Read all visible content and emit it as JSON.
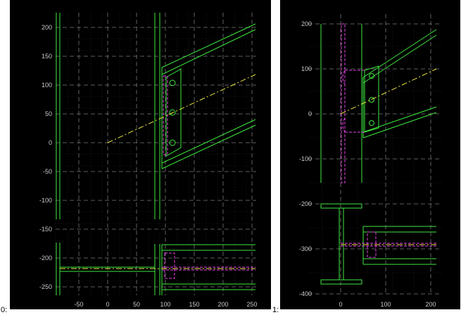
{
  "views": [
    {
      "label": "0:",
      "x_ticks": [
        "-50",
        "0",
        "50",
        "100",
        "150",
        "200",
        "250"
      ],
      "y_ticks": [
        "200",
        "150",
        "100",
        "50",
        "0",
        "-50",
        "-100",
        "-150",
        "-200",
        "-250"
      ]
    },
    {
      "label": "1:",
      "x_ticks": [
        "0",
        "100",
        "200"
      ],
      "y_ticks": [
        "200",
        "100",
        "0",
        "-100",
        "-200",
        "-300",
        "-400"
      ]
    }
  ],
  "colors": {
    "background": "#000000",
    "steel_outline": "#3ee83e",
    "bolt_detail": "#e040e0",
    "centerline": "#e8e43a",
    "grid": "#7a7a7a",
    "tick_text": "#c8c8c8"
  }
}
